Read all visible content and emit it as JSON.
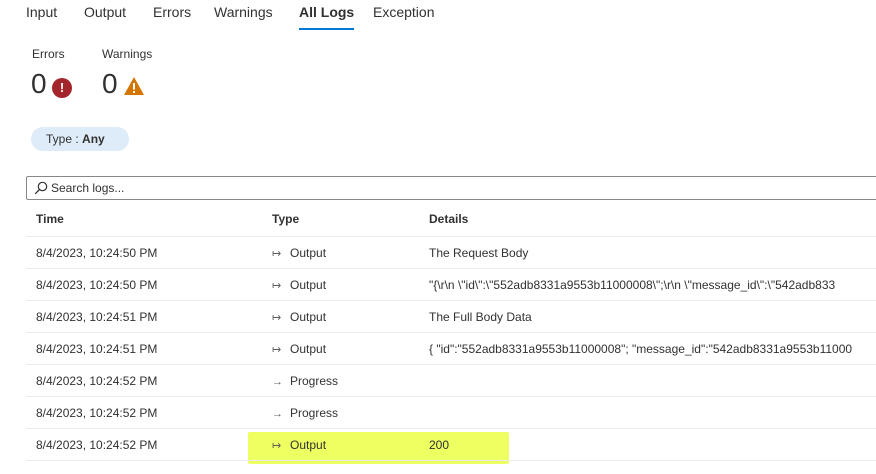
{
  "tabs": [
    {
      "label": "Input",
      "active": false
    },
    {
      "label": "Output",
      "active": false
    },
    {
      "label": "Errors",
      "active": false
    },
    {
      "label": "Warnings",
      "active": false
    },
    {
      "label": "All Logs",
      "active": true
    },
    {
      "label": "Exception",
      "active": false
    }
  ],
  "summary": {
    "errors_label": "Errors",
    "errors_value": "0",
    "warnings_label": "Warnings",
    "warnings_value": "0"
  },
  "filter": {
    "prefix": "Type : ",
    "value": "Any"
  },
  "search": {
    "placeholder": "Search logs..."
  },
  "columns": {
    "time": "Time",
    "type": "Type",
    "details": "Details"
  },
  "rows": [
    {
      "time": "8/4/2023, 10:24:50 PM",
      "type": "Output",
      "type_icon": "output-icon",
      "details": "The Request Body"
    },
    {
      "time": "8/4/2023, 10:24:50 PM",
      "type": "Output",
      "type_icon": "output-icon",
      "details": "\"{\\r\\n \\\"id\\\":\\\"552adb8331a9553b11000008\\\";\\r\\n \\\"message_id\\\":\\\"542adb833"
    },
    {
      "time": "8/4/2023, 10:24:51 PM",
      "type": "Output",
      "type_icon": "output-icon",
      "details": "The Full Body Data"
    },
    {
      "time": "8/4/2023, 10:24:51 PM",
      "type": "Output",
      "type_icon": "output-icon",
      "details": "{ \"id\":\"552adb8331a9553b11000008\"; \"message_id\":\"542adb8331a9553b11000"
    },
    {
      "time": "8/4/2023, 10:24:52 PM",
      "type": "Progress",
      "type_icon": "arrow-right-icon",
      "details": ""
    },
    {
      "time": "8/4/2023, 10:24:52 PM",
      "type": "Progress",
      "type_icon": "arrow-right-icon",
      "details": ""
    },
    {
      "time": "8/4/2023, 10:24:52 PM",
      "type": "Output",
      "type_icon": "output-icon",
      "details": "200"
    }
  ],
  "colors": {
    "accent": "#0078d4",
    "error": "#a4262c",
    "warning": "#d47500",
    "highlight": "#eaff45",
    "pill": "#deecf9"
  }
}
